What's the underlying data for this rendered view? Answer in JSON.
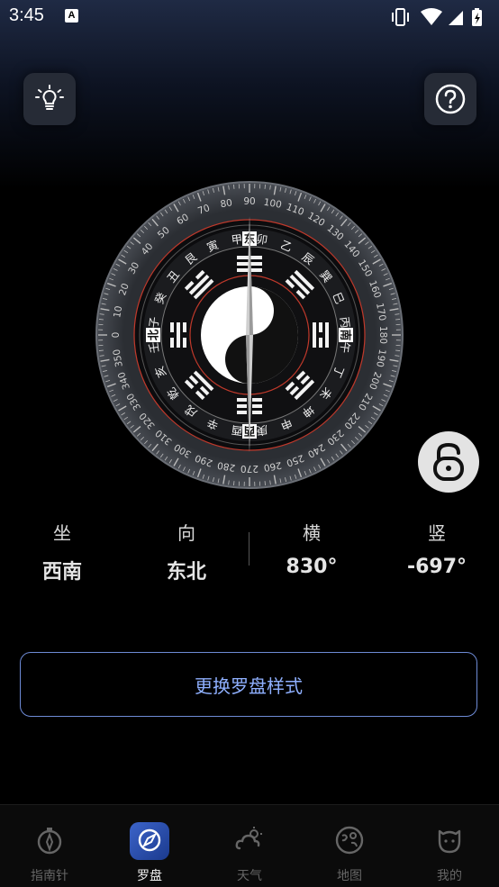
{
  "status_bar": {
    "time": "3:45",
    "notification_glyph": "A",
    "icons": [
      "vibrate-icon",
      "wifi-icon",
      "signal-icon",
      "battery-charging-icon"
    ]
  },
  "top_buttons": {
    "left_icon": "lightbulb-icon",
    "right_icon": "help-icon"
  },
  "compass": {
    "degree_labels": [
      "0",
      "10",
      "20",
      "30",
      "40",
      "50",
      "60",
      "70",
      "80",
      "90",
      "100",
      "110",
      "120",
      "130",
      "140",
      "150",
      "160",
      "170",
      "180",
      "190",
      "200",
      "210",
      "220",
      "230",
      "240",
      "250",
      "260",
      "270",
      "280",
      "290",
      "300",
      "310",
      "320",
      "330",
      "340",
      "350"
    ],
    "directions": {
      "east": "东",
      "south": "南",
      "west": "西",
      "north": "北"
    },
    "mountains": [
      "卯",
      "乙",
      "辰",
      "巽",
      "巳",
      "丙",
      "午",
      "丁",
      "未",
      "坤",
      "申",
      "庚",
      "酉",
      "辛",
      "戌",
      "乾",
      "亥",
      "壬",
      "子",
      "癸",
      "丑",
      "艮",
      "寅",
      "甲"
    ],
    "colors": {
      "ring": "#3a3d42",
      "red_ring": "#c0392b",
      "needle": "#d0d0d0"
    }
  },
  "lock_icon": "unlock-icon",
  "readings": {
    "zuo_label": "坐",
    "zuo_value": "西南",
    "xiang_label": "向",
    "xiang_value": "东北",
    "heng_label": "横",
    "heng_value": "830°",
    "shu_label": "竖",
    "shu_value": "-697°"
  },
  "change_button": {
    "label": "更换罗盘样式"
  },
  "tabs": [
    {
      "label": "指南针",
      "icon": "compass-icon",
      "active": false
    },
    {
      "label": "罗盘",
      "icon": "luopan-icon",
      "active": true
    },
    {
      "label": "天气",
      "icon": "weather-icon",
      "active": false
    },
    {
      "label": "地图",
      "icon": "map-icon",
      "active": false
    },
    {
      "label": "我的",
      "icon": "profile-icon",
      "active": false
    }
  ],
  "accent_color": "#8fb0ff"
}
